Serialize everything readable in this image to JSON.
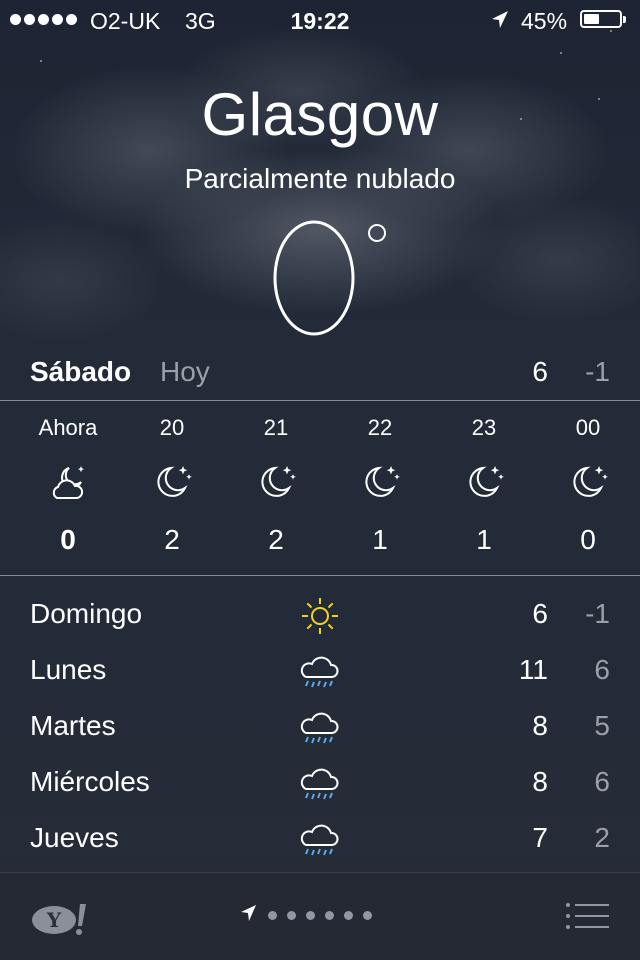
{
  "status_bar": {
    "carrier": "O2-UK",
    "network": "3G",
    "time": "19:22",
    "battery_percent": "45%",
    "battery_level": 0.45,
    "location_icon": "location-arrow-icon"
  },
  "header": {
    "city": "Glasgow",
    "condition": "Parcialmente nublado",
    "temperature": "0"
  },
  "today": {
    "day": "Sábado",
    "label": "Hoy",
    "high": "6",
    "low": "-1"
  },
  "hourly": [
    {
      "time": "Ahora",
      "icon": "partly-cloudy-night-icon",
      "temp": "0"
    },
    {
      "time": "20",
      "icon": "moon-stars-icon",
      "temp": "2"
    },
    {
      "time": "21",
      "icon": "moon-stars-icon",
      "temp": "2"
    },
    {
      "time": "22",
      "icon": "moon-stars-icon",
      "temp": "1"
    },
    {
      "time": "23",
      "icon": "moon-stars-icon",
      "temp": "1"
    },
    {
      "time": "00",
      "icon": "moon-stars-icon",
      "temp": "0"
    }
  ],
  "daily": [
    {
      "day": "Domingo",
      "icon": "sun-icon",
      "high": "6",
      "low": "-1"
    },
    {
      "day": "Lunes",
      "icon": "rain-cloud-icon",
      "high": "11",
      "low": "6"
    },
    {
      "day": "Martes",
      "icon": "rain-cloud-icon",
      "high": "8",
      "low": "5"
    },
    {
      "day": "Miércoles",
      "icon": "rain-cloud-icon",
      "high": "8",
      "low": "6"
    },
    {
      "day": "Jueves",
      "icon": "rain-cloud-icon",
      "high": "7",
      "low": "2"
    }
  ],
  "bottom_bar": {
    "logo_text": "Y!",
    "page_count": 6,
    "current_page": 0
  },
  "colors": {
    "sun": "#f5d020",
    "rain": "#5aa9e6",
    "secondary_text": "#9a9fa8"
  }
}
